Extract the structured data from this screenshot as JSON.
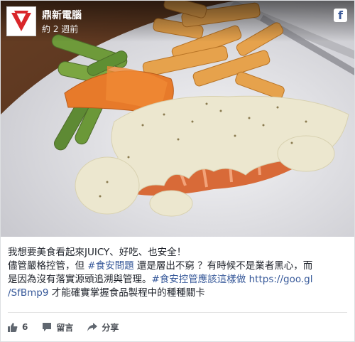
{
  "post": {
    "page_name": "鼎新電腦",
    "timestamp": "約 2 週前",
    "line1": "我想要美食看起來JUICY、好吃、也安全！",
    "line2_pre": "儘管嚴格控管，但 ",
    "line2_hashtag": "#食安問題",
    "line2_post": " 還是層出不窮 ？有時候不是業者黑心，而",
    "line3_pre": "是因為沒有落實源頭追溯與管理。",
    "line3_hashtag": "#食安控管應該這樣做",
    "line3_link": " https://goo.gl",
    "line4_link": "/SfBmp9",
    "line4_post": " 才能確實掌握食品製程中的種種關卡"
  },
  "actions": {
    "like_count": "6",
    "comment_label": "留言",
    "share_label": "分享"
  },
  "icons": {
    "facebook": "facebook-icon",
    "like": "thumbs-up-icon",
    "comment": "comment-icon",
    "share": "share-icon"
  },
  "colors": {
    "link": "#365899",
    "brand_red": "#d9262a"
  }
}
